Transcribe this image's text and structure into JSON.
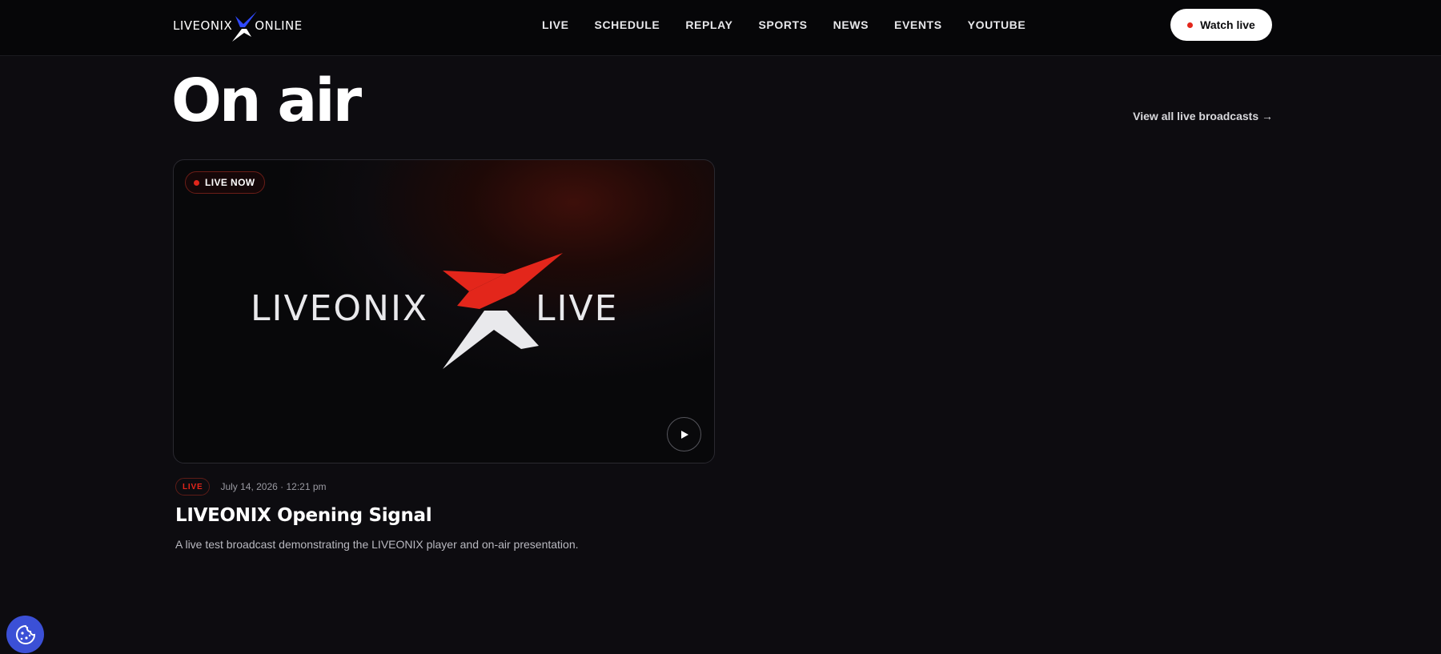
{
  "header": {
    "logo": {
      "left": "LIVEONIX",
      "right": "ONLINE"
    },
    "nav": [
      "LIVE",
      "SCHEDULE",
      "REPLAY",
      "SPORTS",
      "NEWS",
      "EVENTS",
      "YOUTUBE"
    ],
    "watch_live_label": "Watch live"
  },
  "main": {
    "title": "On air",
    "view_all_label": "View all live broadcasts →"
  },
  "broadcast": {
    "status_pill": "LIVE NOW",
    "thumbnail_logo": {
      "left": "LIVEONIX",
      "right": "LIVE"
    },
    "badge": "LIVE",
    "date": "July 14, 2026 · 12:21 pm",
    "title": "LIVEONIX Opening Signal",
    "description": "A live test broadcast demonstrating the LIVEONIX player and on-air presentation."
  },
  "icons": [
    "logo-x-icon",
    "live-dot-icon",
    "play-icon",
    "cookie-icon"
  ],
  "colors": {
    "accent_red": "#e3261b",
    "brand_blue": "#2f49ff",
    "background": "#0d0c10",
    "cookie_button": "#3b50d6"
  }
}
